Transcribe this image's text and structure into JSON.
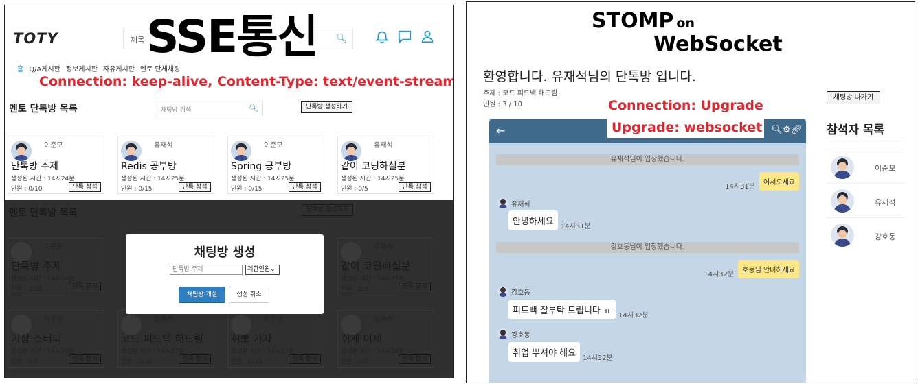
{
  "left": {
    "brand": "TOTY",
    "overlay_title": "SSE통신",
    "top_search_placeholder": "제목",
    "nav": [
      "홈",
      "Q/A게시판",
      "정보게시판",
      "자유게시판",
      "멘토 단체채팅"
    ],
    "red_note": "Connection: keep-alive, Content-Type: text/event-stream",
    "list_title": "멘토 단톡방 목록",
    "list_search_placeholder": "채팅방 검색",
    "create_button": "단톡방 생성하기",
    "cards": [
      {
        "owner": "이준모",
        "title": "단톡방 주제",
        "time": "생성된 시간 : 14시24분",
        "count": "인원 : 0/10",
        "join": "단톡 참석"
      },
      {
        "owner": "유재석",
        "title": "Redis 공부방",
        "time": "생성된 시간 : 14시25분",
        "count": "인원 : 0/15",
        "join": "단톡 참석"
      },
      {
        "owner": "이준모",
        "title": "Spring 공부방",
        "time": "생성된 시간 : 14시25분",
        "count": "인원 : 0/15",
        "join": "단톡 참석"
      },
      {
        "owner": "유재석",
        "title": "같이 코딩하실분",
        "time": "생성된 시간 : 14시25분",
        "count": "인원 : 0/5",
        "join": "단톡 참석"
      }
    ],
    "dim": {
      "list_title": "멘토 단톡방 목록",
      "search_placeholder": "채팅방 검색",
      "create_button": "단톡방 생성하기",
      "row1": [
        {
          "owner": "이준모",
          "title": "단톡방 주제",
          "time": "생성된 시간 : 14시24분",
          "count": "인원 : 0/10",
          "join": "단톡 참석"
        },
        {
          "owner": "유재석",
          "title": "같이 코딩하실분",
          "time": "생성된 시간 : 14시25분",
          "count": "인원 : 0/5",
          "join": "단톡 참석"
        }
      ],
      "row2": [
        {
          "owner": "이준모",
          "title": "기상 스터디",
          "time": "생성된 시간 : 14시26분",
          "count": "인원 : 0/5",
          "join": "단톡 참석"
        },
        {
          "owner": "유재석",
          "title": "코드 피드백 해드림",
          "time": "생성된 시간 : 14시27분",
          "count": "인원 : 0/10",
          "join": "단톡 참석"
        },
        {
          "owner": "이준모",
          "title": "취뽀 가자",
          "time": "생성된 시간 : 14시27분",
          "count": "인원 : 0/15",
          "join": "단톡 참석"
        },
        {
          "owner": "유재석",
          "title": "쉬게 이제",
          "time": "생성된 시간 : 14시28분",
          "count": "인원 : 0/5",
          "join": "단톡 참석"
        }
      ]
    },
    "modal": {
      "title": "채팅방 생성",
      "topic_placeholder": "단톡방 주제",
      "limit_select": "제한인원",
      "create_button": "채팅방 개설",
      "cancel_button": "생성 취소"
    }
  },
  "right": {
    "title_line1": "STOMP",
    "title_small": "on",
    "title_line2": "WebSocket",
    "welcome": "환영합니다. 유재석님의 단톡방 입니다.",
    "topic": "주제 : 코드 피드백 해드림",
    "members": "인원 : 3 / 10",
    "leave_button": "채팅방 나가기",
    "red_note1": "Connection: Upgrade",
    "red_note2": "Upgrade: websocket",
    "messages": {
      "sys1": "유재석님이 입장했습니다.",
      "me1_time": "14시31분",
      "me1_text": "어서오세요",
      "o1_name": "유재석",
      "o1_text": "안녕하세요",
      "o1_time": "14시31분",
      "sys2": "강호동님이 입장했습니다.",
      "me2_time": "14시32분",
      "me2_text": "호동님 안녀하세요",
      "o2_name": "강호동",
      "o2_text": "피드백 잘부탁 드립니다 ㅠ",
      "o2_time": "14시32분",
      "o3_name": "강호동",
      "o3_text": "취업 뿌셔야 해요",
      "o3_time": "14시32분"
    },
    "participants_title": "참석자 목록",
    "participants": [
      "이준모",
      "유재석",
      "강호동"
    ]
  }
}
